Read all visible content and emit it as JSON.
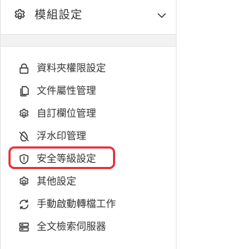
{
  "header": {
    "title": "模組設定",
    "icon": "gear-icon",
    "toggle_icon": "chevron-down-icon"
  },
  "menu": {
    "items": [
      {
        "label": "資料夾權限設定",
        "icon": "lock-icon"
      },
      {
        "label": "文件屬性管理",
        "icon": "documents-icon"
      },
      {
        "label": "自訂欄位管理",
        "icon": "gear-icon"
      },
      {
        "label": "浮水印管理",
        "icon": "watermark-icon"
      },
      {
        "label": "安全等級設定",
        "icon": "shield-icon"
      },
      {
        "label": "其他設定",
        "icon": "gear-icon"
      },
      {
        "label": "手動啟動轉檔工作",
        "icon": "sync-icon"
      },
      {
        "label": "全文檢索伺服器",
        "icon": "server-icon"
      }
    ]
  },
  "colors": {
    "highlight": "#e8313c",
    "text": "#333333",
    "divider": "#e6e6e6",
    "gap": "#f2f2f2"
  }
}
